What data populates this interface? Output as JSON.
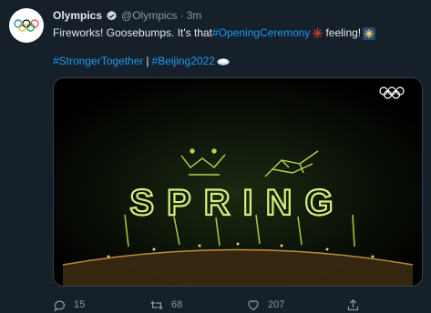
{
  "tweet": {
    "author_name": "Olympics",
    "handle": "@Olympics",
    "time": "3m",
    "text_part1": "Fireworks! Goosebumps. It's that ",
    "hashtag1": "#OpeningCeremony",
    "text_part2": " feeling! ",
    "hashtag2": "#StrongerTogether",
    "separator": "|",
    "hashtag3": "#Beijing2022"
  },
  "media": {
    "firework_text": "SPRING"
  },
  "actions": {
    "reply_count": "15",
    "retweet_count": "68",
    "like_count": "207"
  },
  "icons": {
    "avatar": "olympic-rings-icon",
    "verified": "verified-badge-icon",
    "emoji1": "firework-emoji-icon",
    "emoji2": "sparkler-emoji-icon",
    "emoji3": "snow-emoji-icon",
    "reply": "reply-icon",
    "retweet": "retweet-icon",
    "like": "heart-icon",
    "share": "share-icon"
  },
  "colors": {
    "background": "#15202b",
    "link": "#1d9bf0",
    "muted": "#8b98a5",
    "firework": "#c8e85a"
  }
}
